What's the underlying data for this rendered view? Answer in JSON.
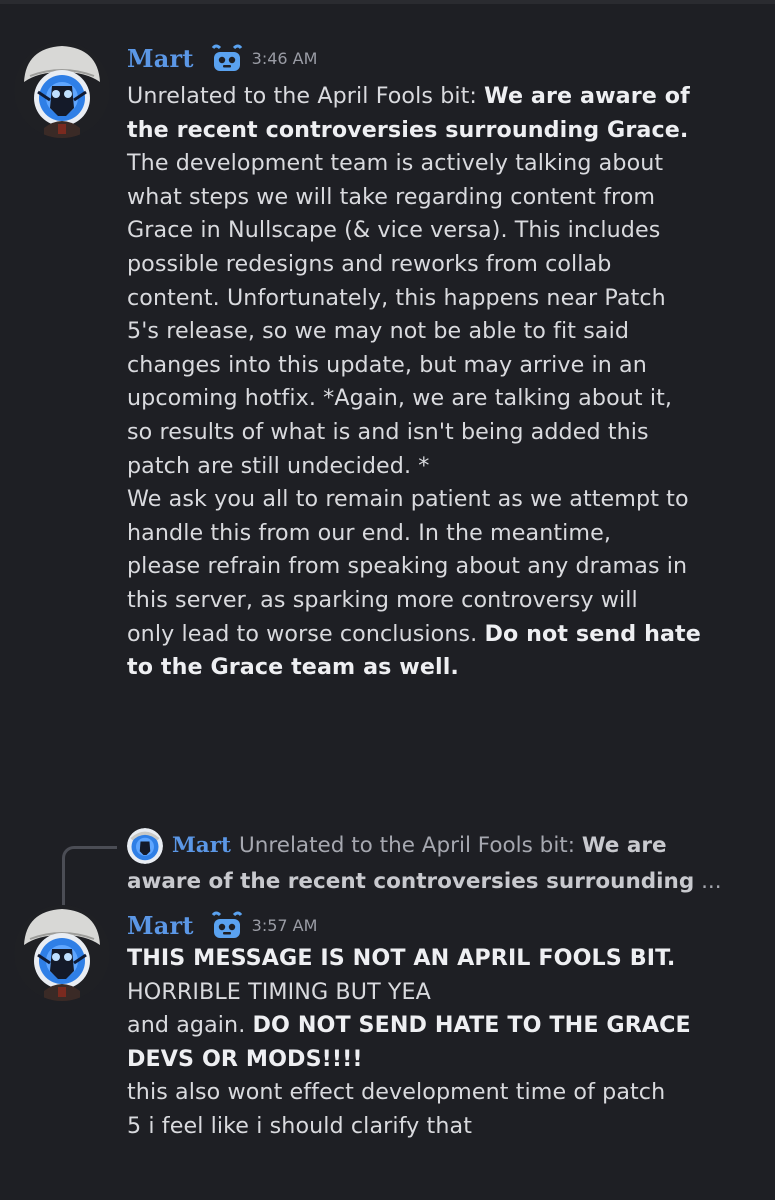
{
  "colors": {
    "background": "#1e1f24",
    "username": "#5b97e6",
    "text": "#d9dade",
    "timestamp": "#9a9ca5"
  },
  "messages": [
    {
      "author": "Mart",
      "badge_icon": "robot-badge-icon",
      "time": "3:46 AM",
      "lines": [
        {
          "pre": "Unrelated to the April Fools bit: ",
          "bold": "We are aware of",
          "post": ""
        },
        {
          "pre": "",
          "bold": "the recent controversies surrounding Grace.",
          "post": ""
        },
        {
          "pre": "The development team is actively talking about",
          "bold": "",
          "post": ""
        },
        {
          "pre": "what steps we will take regarding content from",
          "bold": "",
          "post": ""
        },
        {
          "pre": "Grace in Nullscape (& vice versa). This includes",
          "bold": "",
          "post": ""
        },
        {
          "pre": "possible redesigns and reworks from collab",
          "bold": "",
          "post": ""
        },
        {
          "pre": "content. Unfortunately, this happens near Patch",
          "bold": "",
          "post": ""
        },
        {
          "pre": "5's release, so we may not be able to fit said",
          "bold": "",
          "post": ""
        },
        {
          "pre": "changes into this update, but may arrive in an",
          "bold": "",
          "post": ""
        },
        {
          "pre": "upcoming hotfix. *Again, we are talking about it,",
          "bold": "",
          "post": ""
        },
        {
          "pre": "so results of what is and isn't being added this",
          "bold": "",
          "post": ""
        },
        {
          "pre": "patch are still undecided. *",
          "bold": "",
          "post": ""
        },
        {
          "pre": "We ask you all to remain patient as we attempt to",
          "bold": "",
          "post": ""
        },
        {
          "pre": "handle this from our end. In the meantime,",
          "bold": "",
          "post": ""
        },
        {
          "pre": "please refrain from speaking about any dramas in",
          "bold": "",
          "post": ""
        },
        {
          "pre": "this server, as sparking more controversy will",
          "bold": "",
          "post": ""
        },
        {
          "pre": "only lead to worse conclusions. ",
          "bold": "Do not send hate",
          "post": ""
        },
        {
          "pre": "",
          "bold": "to the Grace team as well.",
          "post": ""
        }
      ]
    },
    {
      "author": "Mart",
      "badge_icon": "robot-badge-icon",
      "time": "3:57 AM",
      "reply": {
        "author": "Mart",
        "line1_pre": "Unrelated to the April Fools bit: ",
        "line1_bold": "We are",
        "line2_bold": "aware of the recent controversies surrounding",
        "line2_post": " ..."
      },
      "lines": [
        {
          "pre": "",
          "bold": "THIS MESSAGE IS NOT AN APRIL FOOLS BIT.",
          "post": ""
        },
        {
          "pre": "HORRIBLE TIMING BUT YEA",
          "bold": "",
          "post": ""
        },
        {
          "pre": "and again. ",
          "bold": "DO NOT SEND HATE TO THE GRACE",
          "post": ""
        },
        {
          "pre": "",
          "bold": "DEVS OR MODS!!!!",
          "post": ""
        },
        {
          "pre": "this also wont effect development time of patch",
          "bold": "",
          "post": ""
        },
        {
          "pre": "5 i feel like i should clarify that",
          "bold": "",
          "post": ""
        }
      ]
    }
  ]
}
